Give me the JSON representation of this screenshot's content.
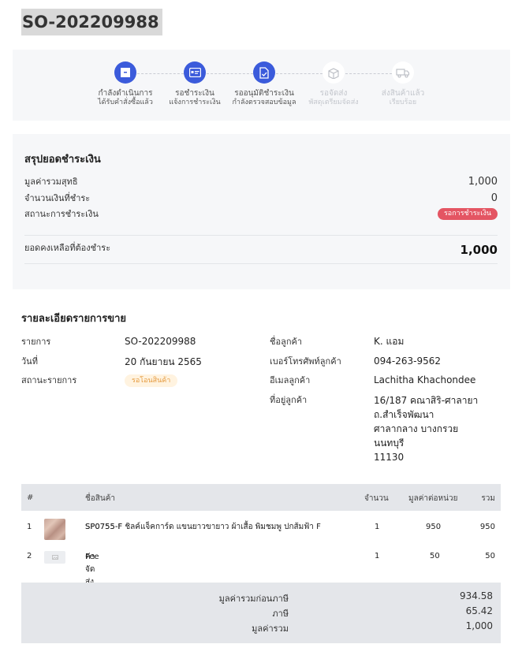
{
  "order": {
    "id": "SO-202209988"
  },
  "stepper": {
    "steps": [
      {
        "label1": "กำลังดำเนินการ",
        "label2": "ได้รับคำสั่งซื้อแล้ว",
        "icon": "box-icon",
        "state": "active"
      },
      {
        "label1": "รอชำระเงิน",
        "label2": "แจ้งการชำระเงิน",
        "icon": "card-icon",
        "state": "active"
      },
      {
        "label1": "รออนุมัติชำระเงิน",
        "label2": "กำลังตรวจสอบข้อมูล",
        "icon": "document-check-icon",
        "state": "active"
      },
      {
        "label1": "รอจัดส่ง",
        "label2": "พัสดุเตรียมจัดส่ง",
        "icon": "package-icon",
        "state": "inactive"
      },
      {
        "label1": "ส่งสินค้าแล้ว",
        "label2": "เรียบร้อย",
        "icon": "truck-icon",
        "state": "inactive"
      }
    ],
    "colors": {
      "active": "#3b5bdb",
      "inactive": "#c4c7cd"
    }
  },
  "summary": {
    "title": "สรุปยอดชำระเงิน",
    "net_total_label": "มูลค่ารวมสุทธิ",
    "net_total_value": "1,000",
    "paid_label": "จำนวนเงินที่ชำระ",
    "paid_value": "0",
    "payment_status_label": "สถานะการชำระเงิน",
    "payment_status_value": "รอการชำระเงิน",
    "balance_label": "ยอดคงเหลือที่ต้องชำระ",
    "balance_value": "1,000",
    "status_color": "#e45563"
  },
  "details": {
    "title": "รายละเอียดรายการขาย",
    "order_label": "รายการ",
    "order_value": "SO-202209988",
    "date_label": "วันที่",
    "date_value": "20 กันยายน 2565",
    "status_label": "สถานะรายการ",
    "status_value": "รอโอนสินค้า",
    "customer_label": "ชื่อลูกค้า",
    "customer_value": "K. แอม",
    "phone_label": "เบอร์โทรศัพท์ลูกค้า",
    "phone_value": "094-263-9562",
    "email_label": "อีเมลลูกค้า",
    "email_value": "Lachitha Khachondee",
    "address_label": "ที่อยู่ลูกค้า",
    "address_lines": [
      "16/187 คณาสิริ-ศาลายา",
      "ถ.สำเร็จพัฒนา",
      "ศาลากลาง บางกรวย",
      "นนทบุรี",
      "11130"
    ]
  },
  "table": {
    "headers": {
      "no": "#",
      "name": "ชื่อสินค้า",
      "qty": "จำนวน",
      "unit_price": "มูลค่าต่อหน่วย",
      "total": "รวม"
    },
    "rows": [
      {
        "no": "1",
        "name": "SP0755-F ชิลค์แจ็คการ์ด แขนยาวขายาว ผ้าเสื้อ พิมชมพู ปกส้มฟ้า F",
        "sku": "SP0755-F",
        "qty": "1",
        "unit_price": "950",
        "total": "950"
      },
      {
        "no": "2",
        "name": "ค่าจัดส่ง",
        "sku": "Fee",
        "qty": "1",
        "unit_price": "50",
        "total": "50"
      }
    ],
    "footer": {
      "subtotal_label": "มูลค่ารวมก่อนภาษี",
      "subtotal_value": "934.58",
      "tax_label": "ภาษี",
      "tax_value": "65.42",
      "grand_label": "มูลค่ารวม",
      "grand_value": "1,000"
    }
  }
}
